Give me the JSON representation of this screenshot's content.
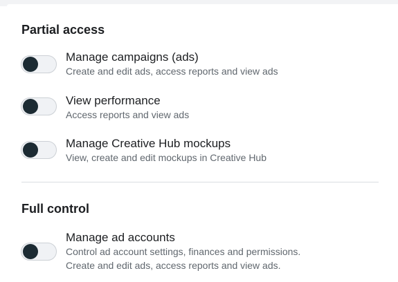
{
  "partial_access": {
    "title": "Partial access",
    "items": [
      {
        "title": "Manage campaigns (ads)",
        "description": "Create and edit ads, access reports and view ads",
        "enabled": false
      },
      {
        "title": "View performance",
        "description": "Access reports and view ads",
        "enabled": false
      },
      {
        "title": "Manage Creative Hub mockups",
        "description": "View, create and edit mockups in Creative Hub",
        "enabled": false
      }
    ]
  },
  "full_control": {
    "title": "Full control",
    "items": [
      {
        "title": "Manage ad accounts",
        "description_lines": [
          "Control ad account settings, finances and permissions.",
          "Create and edit ads, access reports and view ads."
        ],
        "enabled": false
      }
    ]
  },
  "colors": {
    "toggle_knob": "#1c2b33",
    "toggle_track": "#f0f2f5",
    "divider": "#dadde1",
    "description_text": "#60676e"
  }
}
